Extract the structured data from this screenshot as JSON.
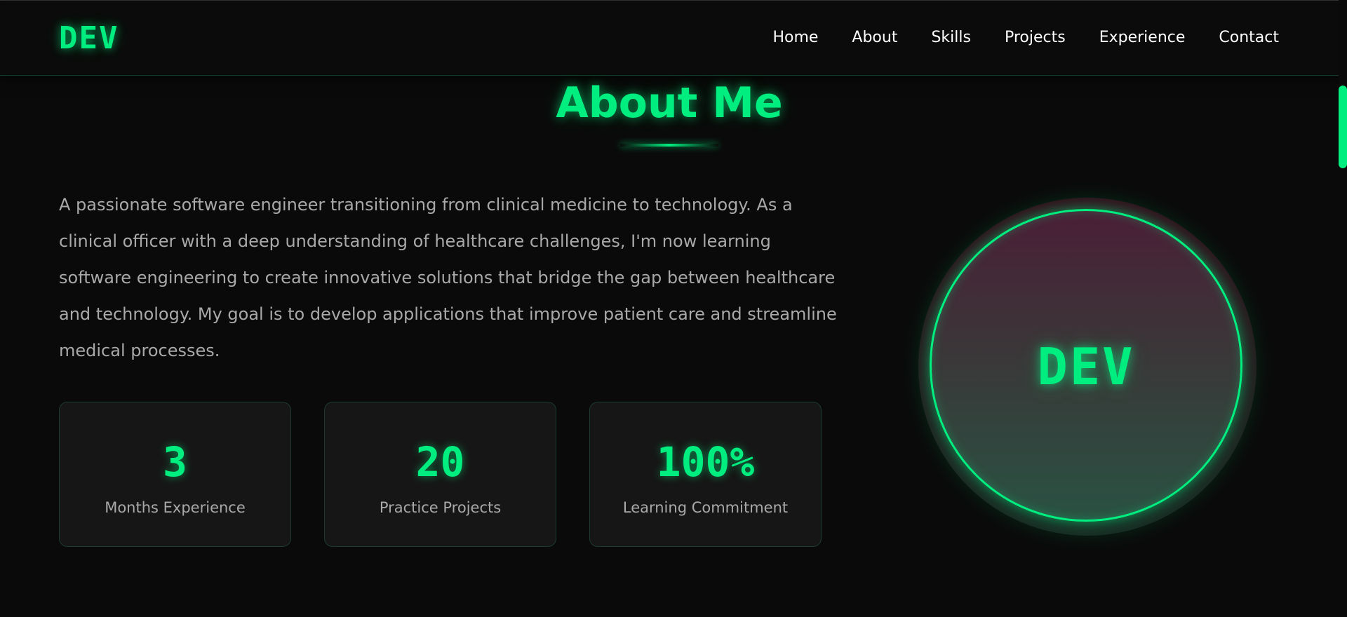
{
  "brand": {
    "logo": "DEV"
  },
  "nav": {
    "items": [
      "Home",
      "About",
      "Skills",
      "Projects",
      "Experience",
      "Contact"
    ]
  },
  "about": {
    "title": "About Me",
    "paragraph": "A passionate software engineer transitioning from clinical medicine to technology. As a clinical officer with a deep understanding of healthcare challenges, I'm now learning software engineering to create innovative solutions that bridge the gap between healthcare and technology. My goal is to develop applications that improve patient care and streamline medical processes.",
    "stats": [
      {
        "value": "3",
        "label": "Months Experience"
      },
      {
        "value": "20",
        "label": "Practice Projects"
      },
      {
        "value": "100%",
        "label": "Learning Commitment"
      }
    ],
    "avatar_text": "DEV"
  },
  "theme": {
    "accent": "#00ee7f",
    "background": "#0a0a0a",
    "card": "#161616",
    "text_muted": "#a9a9a9"
  }
}
